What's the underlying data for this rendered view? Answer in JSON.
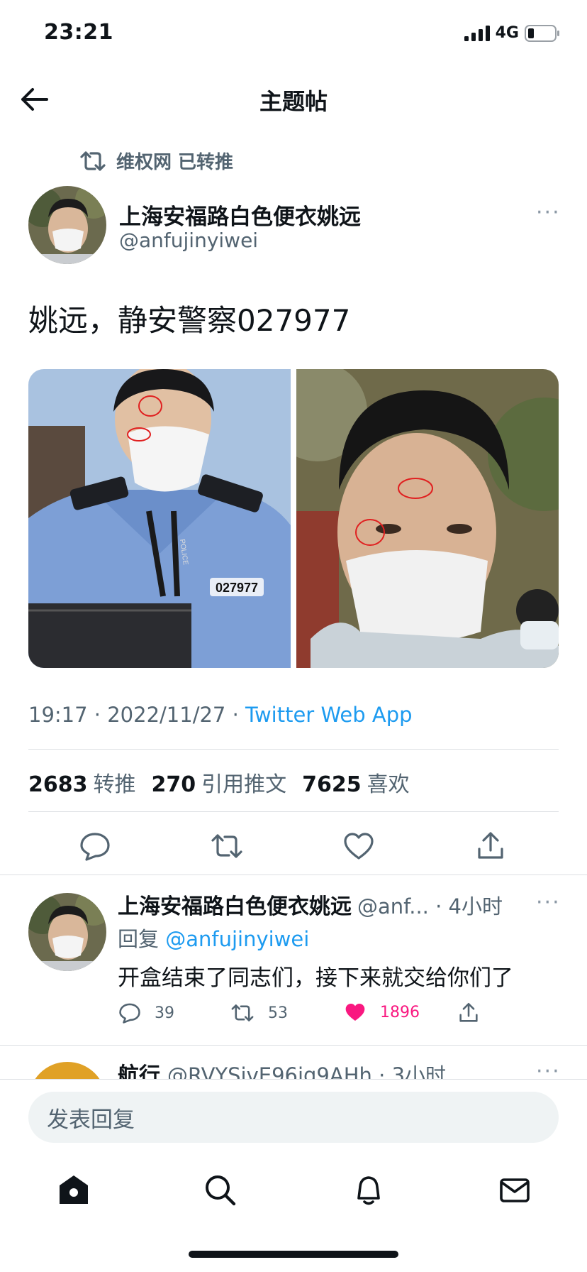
{
  "status": {
    "time": "23:21",
    "network": "4G"
  },
  "header": {
    "title": "主题帖"
  },
  "retweet": {
    "label": "维权网 已转推"
  },
  "tweet": {
    "author_name": "上海安福路白色便衣姚远",
    "author_handle": "@anfujinyiwei",
    "text": "姚远，静安警察027977",
    "timestamp": "19:17 · 2022/11/27 · ",
    "source": "Twitter Web App",
    "stats": [
      {
        "value": "2683",
        "label": "转推"
      },
      {
        "value": "270",
        "label": "引用推文"
      },
      {
        "value": "7625",
        "label": "喜欢"
      }
    ],
    "photo_badge": "027977",
    "photo_text": "POLICE"
  },
  "reply": {
    "author_name": "上海安福路白色便衣姚远",
    "handle_time": "@anf... · 4小时",
    "reply_prefix": "回复 ",
    "reply_to": "@anfujinyiwei",
    "text": "开盒结束了同志们，接下来就交给你们了",
    "replies": "39",
    "retweets": "53",
    "likes": "1896"
  },
  "next_reply": {
    "author_name": "航行",
    "handle_time": "@RVYSivE96ig9AHh · 3小时"
  },
  "compose": {
    "placeholder": "发表回复"
  },
  "colors": {
    "accent": "#1d9bf0",
    "like": "#f91880",
    "secondary": "#536471"
  }
}
